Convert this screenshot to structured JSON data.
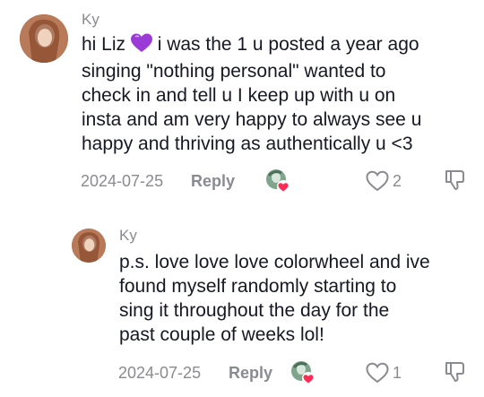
{
  "comments": [
    {
      "author": "Ky",
      "text_before_emoji": "hi Liz ",
      "emoji": "purple-heart",
      "text_after_emoji": " i was the 1 u posted a year ago\nsinging \"nothing personal\" wanted to\ncheck in and tell u I keep up with u on\ninsta and am very happy to always see u\nhappy and thriving as authentically u <3",
      "date": "2024-07-25",
      "reply_label": "Reply",
      "like_count": "2",
      "liked_by_creator": true
    },
    {
      "author": "Ky",
      "text": "p.s. love love love colorwheel and ive\nfound myself randomly starting to\nsing it throughout the day for the\npast couple of weeks lol!",
      "date": "2024-07-25",
      "reply_label": "Reply",
      "like_count": "1",
      "liked_by_creator": true
    }
  ],
  "colors": {
    "text": "#161823",
    "meta": "#8a8b91",
    "heart_badge": "#fe2c55",
    "emoji_heart": "#9b3bd6"
  }
}
